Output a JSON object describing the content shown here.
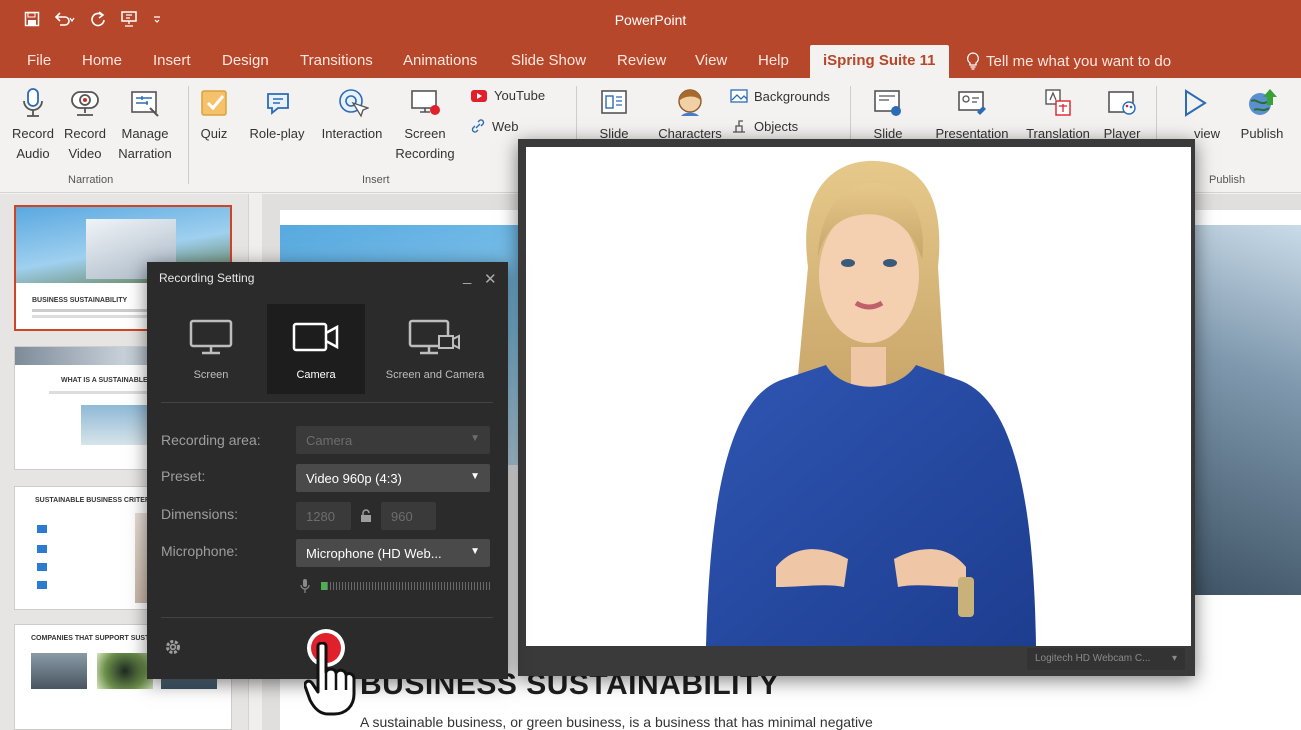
{
  "titlebar": {
    "app_title": "PowerPoint"
  },
  "tabs": [
    {
      "label": "File"
    },
    {
      "label": "Home"
    },
    {
      "label": "Insert"
    },
    {
      "label": "Design"
    },
    {
      "label": "Transitions"
    },
    {
      "label": "Animations"
    },
    {
      "label": "Slide Show"
    },
    {
      "label": "Review"
    },
    {
      "label": "View"
    },
    {
      "label": "Help"
    },
    {
      "label": "iSpring Suite 11",
      "active": true
    }
  ],
  "tell_me": "Tell me what you want to do",
  "ribbon": {
    "narration": {
      "record_audio": [
        "Record",
        "Audio"
      ],
      "record_video": [
        "Record",
        "Video"
      ],
      "manage_narration": [
        "Manage",
        "Narration"
      ],
      "group_label": "Narration"
    },
    "insert": {
      "quiz": "Quiz",
      "role_play": "Role-play",
      "interaction": "Interaction",
      "screen_recording": [
        "Screen",
        "Recording"
      ],
      "youtube": "YouTube",
      "web": "Web",
      "group_label": "Insert"
    },
    "slide_partial": "Slide",
    "characters_partial": "Characters",
    "backgrounds": "Backgrounds",
    "objects": "Objects",
    "slide2_partial": "Slide",
    "presentation_partial": "Presentation",
    "translation_partial": "Translation",
    "player_partial": "Player",
    "preview_partial": "view",
    "publish": "Publish",
    "publish_group_label": "Publish"
  },
  "thumbnails": [
    {
      "title": "BUSINESS SUSTAINABILITY"
    },
    {
      "title": "WHAT IS A SUSTAINABLE"
    },
    {
      "title": "SUSTAINABLE BUSINESS CRITERI"
    },
    {
      "title": "COMPANIES THAT SUPPORT SUSTAIN"
    }
  ],
  "slide": {
    "title": "BUSINESS SUSTAINABILITY",
    "text": "A sustainable business, or green business, is a business that has minimal negative"
  },
  "dialog": {
    "title": "Recording Setting",
    "modes": [
      {
        "label": "Screen",
        "icon": "monitor-icon",
        "active": false
      },
      {
        "label": "Camera",
        "icon": "camera-icon",
        "active": true
      },
      {
        "label": "Screen and Camera",
        "icon": "screen-camera-icon",
        "active": false
      }
    ],
    "recording_area_label": "Recording area:",
    "recording_area_value": "Camera",
    "preset_label": "Preset:",
    "preset_value": "Video 960p (4:3)",
    "dimensions_label": "Dimensions:",
    "width_value": "1280",
    "height_value": "960",
    "microphone_label": "Microphone:",
    "microphone_value": "Microphone (HD Web..."
  },
  "preview": {
    "webcam_value": "Logitech HD Webcam C..."
  },
  "colors": {
    "ribbon_red": "#b7472a",
    "record_red": "#e0202a",
    "dialog_bg": "#2b2b2b",
    "mic_level_green": "#4caf50"
  }
}
